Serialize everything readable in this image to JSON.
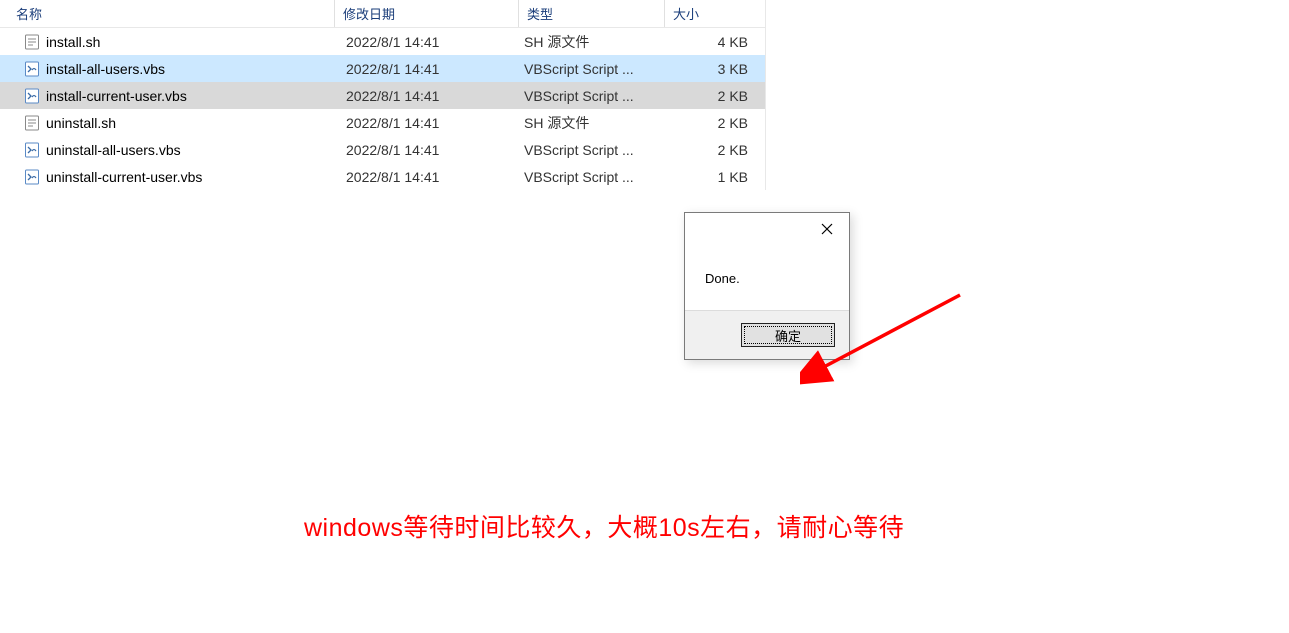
{
  "columns": {
    "name": "名称",
    "date": "修改日期",
    "type": "类型",
    "size": "大小"
  },
  "files": [
    {
      "icon": "sh",
      "name": "install.sh",
      "date": "2022/8/1 14:41",
      "type": "SH 源文件",
      "size": "4 KB",
      "highlight": ""
    },
    {
      "icon": "vbs",
      "name": "install-all-users.vbs",
      "date": "2022/8/1 14:41",
      "type": "VBScript Script ...",
      "size": "3 KB",
      "highlight": "blue"
    },
    {
      "icon": "vbs",
      "name": "install-current-user.vbs",
      "date": "2022/8/1 14:41",
      "type": "VBScript Script ...",
      "size": "2 KB",
      "highlight": "gray"
    },
    {
      "icon": "sh",
      "name": "uninstall.sh",
      "date": "2022/8/1 14:41",
      "type": "SH 源文件",
      "size": "2 KB",
      "highlight": ""
    },
    {
      "icon": "vbs",
      "name": "uninstall-all-users.vbs",
      "date": "2022/8/1 14:41",
      "type": "VBScript Script ...",
      "size": "2 KB",
      "highlight": ""
    },
    {
      "icon": "vbs",
      "name": "uninstall-current-user.vbs",
      "date": "2022/8/1 14:41",
      "type": "VBScript Script ...",
      "size": "1 KB",
      "highlight": ""
    }
  ],
  "dialog": {
    "message": "Done.",
    "ok_label": "确定"
  },
  "caption": "windows等待时间比较久，大概10s左右，请耐心等待"
}
